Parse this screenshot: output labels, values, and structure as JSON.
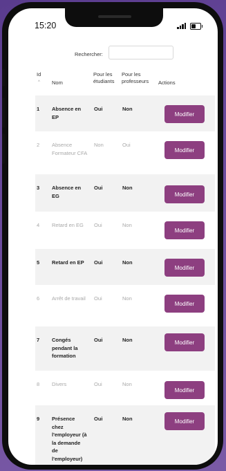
{
  "status_bar": {
    "time": "15:20"
  },
  "search": {
    "label": "Rechercher:",
    "value": ""
  },
  "table": {
    "headers": {
      "id": "Id",
      "name": "Nom",
      "students": "Pour les étudiants",
      "teachers": "Pour les professeurs",
      "actions": "Actions"
    },
    "rows": [
      {
        "id": "1",
        "name": "Absence en EP",
        "students": "Oui",
        "teachers": "Non",
        "action": "Modifier",
        "active": true
      },
      {
        "id": "2",
        "name": "Absence Formateur CFA",
        "students": "Non",
        "teachers": "Oui",
        "action": "Modifier",
        "active": false
      },
      {
        "id": "3",
        "name": "Absence en EG",
        "students": "Oui",
        "teachers": "Non",
        "action": "Modifier",
        "active": true
      },
      {
        "id": "4",
        "name": "Retard en EG",
        "students": "Oui",
        "teachers": "Non",
        "action": "Modifier",
        "active": false
      },
      {
        "id": "5",
        "name": "Retard en EP",
        "students": "Oui",
        "teachers": "Non",
        "action": "Modifier",
        "active": true
      },
      {
        "id": "6",
        "name": "Arrêt de travail",
        "students": "Oui",
        "teachers": "Non",
        "action": "Modifier",
        "active": false
      },
      {
        "id": "7",
        "name": "Congés pendant la formation",
        "students": "Oui",
        "teachers": "Non",
        "action": "Modifier",
        "active": true
      },
      {
        "id": "8",
        "name": "Divers",
        "students": "Oui",
        "teachers": "Non",
        "action": "Modifier",
        "active": false
      },
      {
        "id": "9",
        "name": "Présence chez l'employeur (à la demande de l'employeur)",
        "students": "Oui",
        "teachers": "Non",
        "action": "Modifier",
        "active": true
      }
    ]
  },
  "colors": {
    "button": "#8d3f80",
    "row_shade": "#f2f2f2",
    "background": "#6a4a9c"
  }
}
